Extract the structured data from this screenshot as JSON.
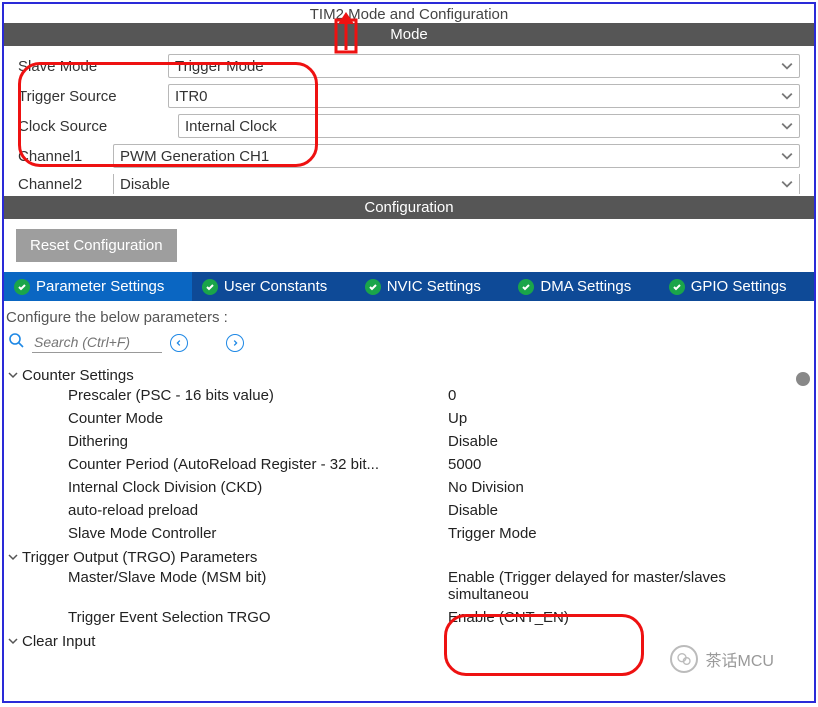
{
  "title": "TIM2 Mode and Configuration",
  "mode": {
    "band": "Mode",
    "rows": [
      {
        "label": "Slave Mode",
        "value": "Trigger Mode"
      },
      {
        "label": "Trigger Source",
        "value": "ITR0"
      },
      {
        "label": "Clock Source",
        "value": "Internal Clock"
      },
      {
        "label": "Channel1",
        "value": "PWM Generation CH1"
      },
      {
        "label": "Channel2",
        "value": "Disable"
      }
    ]
  },
  "config_band": "Configuration",
  "reset_btn": "Reset Configuration",
  "tabs": [
    "Parameter Settings",
    "User Constants",
    "NVIC Settings",
    "DMA Settings",
    "GPIO Settings"
  ],
  "instruction": "Configure the below parameters :",
  "search_placeholder": "Search (Ctrl+F)",
  "groups": {
    "counter": {
      "title": "Counter Settings",
      "rows": [
        {
          "name": "Prescaler (PSC - 16 bits value)",
          "value": "0"
        },
        {
          "name": "Counter Mode",
          "value": "Up"
        },
        {
          "name": "Dithering",
          "value": "Disable"
        },
        {
          "name": "Counter Period (AutoReload Register - 32 bit...",
          "value": "5000"
        },
        {
          "name": "Internal Clock Division (CKD)",
          "value": "No Division"
        },
        {
          "name": "auto-reload preload",
          "value": "Disable"
        },
        {
          "name": "Slave Mode Controller",
          "value": "Trigger Mode"
        }
      ]
    },
    "trgo": {
      "title": "Trigger Output (TRGO) Parameters",
      "rows": [
        {
          "name": "Master/Slave Mode (MSM bit)",
          "value": "Enable (Trigger delayed for master/slaves simultaneou"
        },
        {
          "name": "Trigger Event Selection TRGO",
          "value": "Enable (CNT_EN)"
        }
      ]
    },
    "clear": {
      "title": "Clear Input"
    }
  },
  "watermark": "茶话MCU"
}
